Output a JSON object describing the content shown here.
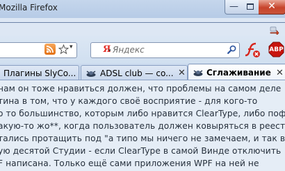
{
  "window": {
    "title": "Mozilla Firefox",
    "controls": {
      "minimize": "—",
      "close": "✕"
    }
  },
  "navigation": {
    "url_dropmarker": "▾",
    "search": {
      "engine_logo": "Я",
      "engine_dropmarker": "▾",
      "placeholder": "Яндекс",
      "value": ""
    },
    "adblock_label": "ABP"
  },
  "tabs": [
    {
      "label": "Плагины SlyCo...",
      "selected": false
    },
    {
      "label": "ADSL club — co...",
      "selected": false,
      "close": "✕"
    },
    {
      "label": "Сглаживание ...",
      "selected": true,
      "close": "✕"
    }
  ],
  "content": {
    "lines": [
      "нам он тоже нравиться должен, что проблемы на самом деле",
      "тина в том, что у каждого своё восприятие - для кого-то",
      "о то большинство, которым либо нравится ClearType, либо пофиг",
      "акую-то жо**, когда пользователь должен ковыряться в реестре",
      "тались протащить под \"а типо мы ничего не замечаем, и так всё",
      "ую десятой Студии - если ClearType в самой Винде отключить",
      "F написана. Только ещё сами приложения WPF на ней не"
    ]
  },
  "colors": {
    "title_bar": "#c5d6ec",
    "close_button": "#c7432b",
    "content_bg": "#e5edf6",
    "text": "#26303c",
    "rss": "#e26f12",
    "yandex_red": "#e4322b",
    "adblock_red": "#c8140e"
  },
  "icons": [
    "rss-icon",
    "bookmark-star-icon",
    "search-icon",
    "flash-blocked-icon",
    "adblock-plus-icon",
    "download-icon",
    "tab-favicon"
  ]
}
